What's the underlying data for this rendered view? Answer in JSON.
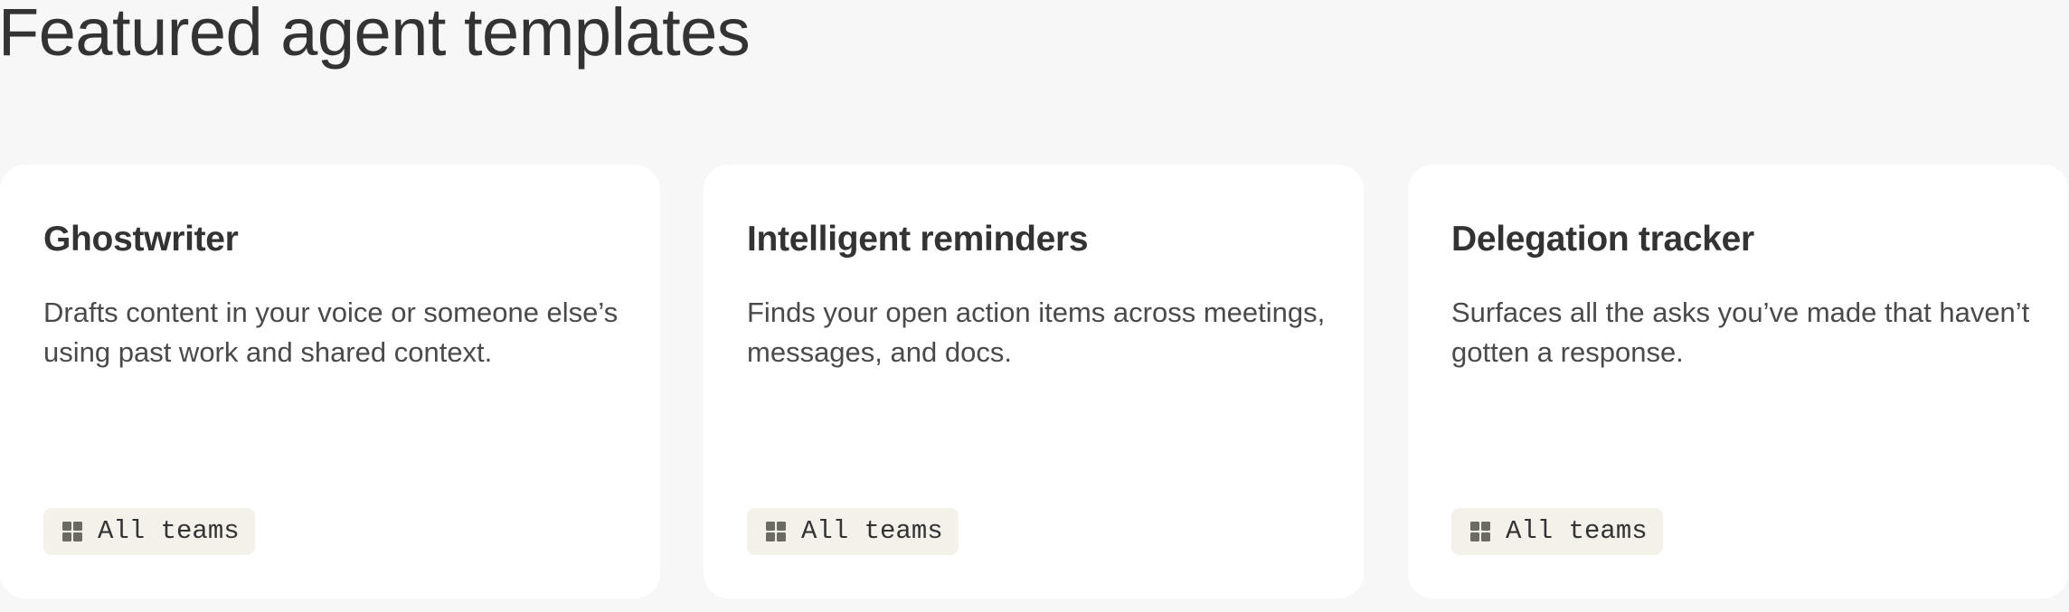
{
  "page": {
    "title": "Featured agent templates"
  },
  "colors": {
    "background": "#f7f7f7",
    "card_background": "#ffffff",
    "tag_background": "#f3f1ea",
    "text_primary": "#333333",
    "text_secondary": "#4a4a4a",
    "icon": "#6b6b62"
  },
  "templates": [
    {
      "title": "Ghostwriter",
      "description": "Drafts content in your voice or someone else’s using past work and shared context.",
      "tag": {
        "icon": "grid-icon",
        "label": "All teams"
      }
    },
    {
      "title": "Intelligent reminders",
      "description": "Finds your open action items across meetings, messages, and docs.",
      "tag": {
        "icon": "grid-icon",
        "label": "All teams"
      }
    },
    {
      "title": "Delegation tracker",
      "description": "Surfaces all the asks you’ve made that haven’t gotten a response.",
      "tag": {
        "icon": "grid-icon",
        "label": "All teams"
      }
    }
  ]
}
